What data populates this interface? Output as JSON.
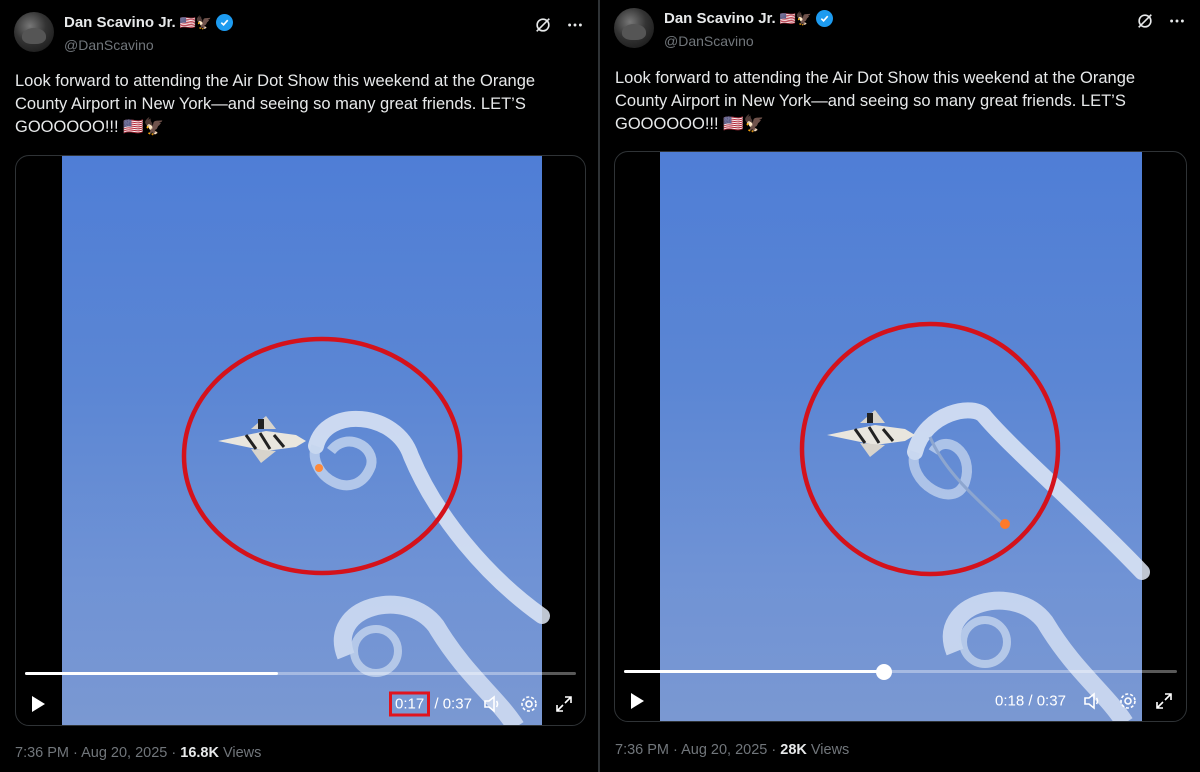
{
  "tweets": [
    {
      "author": {
        "name": "Dan Scavino Jr.",
        "name_emojis": "🇺🇸🦅",
        "handle": "@DanScavino"
      },
      "text_line1": "Look forward to attending the Air Dot Show this weekend at the Orange",
      "text_line2": "County Airport in New York—and seeing so many great friends. LET’S",
      "text_line3": "GOOOOOO!!!",
      "text_emojis": "🇺🇸🦅",
      "video": {
        "current_time": "0:17",
        "separator": "/",
        "duration": "0:37",
        "progress": 0.46,
        "current_time_highlighted": true,
        "annotation_circle_color": "#d4121b"
      },
      "timestamp": "7:36 PM · Aug 20, 2025 · ",
      "views_count": "16.8K",
      "views_label": " Views"
    },
    {
      "author": {
        "name": "Dan Scavino Jr.",
        "name_emojis": "🇺🇸🦅",
        "handle": "@DanScavino"
      },
      "text_line1": "Look forward to attending the Air Dot Show this weekend at the Orange",
      "text_line2": "County Airport in New York—and seeing so many great friends. LET’S",
      "text_line3": "GOOOOOO!!!",
      "text_emojis": "🇺🇸🦅",
      "video": {
        "current_time": "0:18",
        "separator": "/",
        "duration": "0:37",
        "progress": 0.47,
        "current_time_highlighted": false,
        "annotation_circle_color": "#d4121b"
      },
      "timestamp": "7:36 PM · Aug 20, 2025 · ",
      "views_count": "28K",
      "views_label": " Views"
    }
  ],
  "colors": {
    "verified": "#1d9bf0",
    "muted_text": "#71767b",
    "highlight_red": "#e0141e"
  },
  "icons": [
    "verified-badge-icon",
    "grok-icon",
    "more-icon",
    "play-icon",
    "volume-icon",
    "settings-icon",
    "fullscreen-icon"
  ]
}
